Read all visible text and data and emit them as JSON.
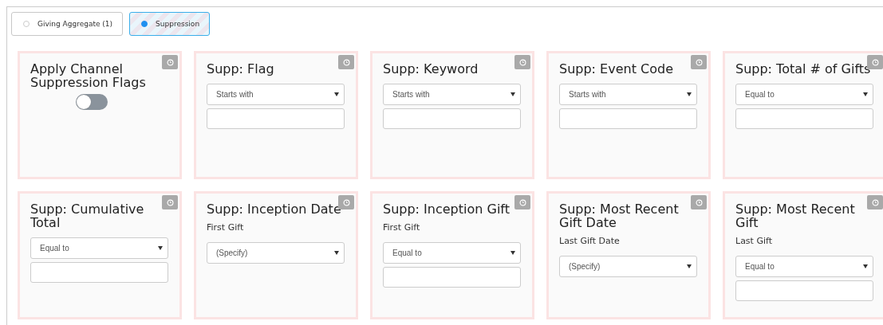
{
  "tabs": [
    {
      "label": "Giving Aggregate (1)",
      "selected": false
    },
    {
      "label": "Suppression",
      "selected": true
    }
  ],
  "cards": [
    {
      "title": "Apply Channel Suppression Flags",
      "controls": [
        {
          "kind": "toggle",
          "on": false
        }
      ]
    },
    {
      "title": "Supp: Flag",
      "controls": [
        {
          "kind": "select",
          "value": "Starts with"
        },
        {
          "kind": "text"
        }
      ]
    },
    {
      "title": "Supp: Keyword",
      "controls": [
        {
          "kind": "select",
          "value": "Starts with"
        },
        {
          "kind": "text"
        }
      ]
    },
    {
      "title": "Supp: Event Code",
      "controls": [
        {
          "kind": "select",
          "value": "Starts with"
        },
        {
          "kind": "text"
        }
      ]
    },
    {
      "title": "Supp: Total # of Gifts",
      "controls": [
        {
          "kind": "select",
          "value": "Equal to"
        },
        {
          "kind": "text"
        }
      ]
    },
    {
      "title": "Supp: Cumulative Total",
      "controls": [
        {
          "kind": "select",
          "value": "Equal to"
        },
        {
          "kind": "text"
        }
      ]
    },
    {
      "title": "Supp: Inception Date",
      "sublabel": "First Gift",
      "controls": [
        {
          "kind": "select",
          "value": "(Specify)"
        }
      ]
    },
    {
      "title": "Supp: Inception Gift",
      "sublabel": "First Gift",
      "controls": [
        {
          "kind": "select",
          "value": "Equal to"
        },
        {
          "kind": "text"
        }
      ]
    },
    {
      "title": "Supp: Most Recent Gift Date",
      "sublabel": "Last Gift Date",
      "controls": [
        {
          "kind": "select",
          "value": "(Specify)"
        }
      ]
    },
    {
      "title": "Supp: Most Recent Gift",
      "sublabel": "Last Gift",
      "controls": [
        {
          "kind": "select",
          "value": "Equal to"
        },
        {
          "kind": "text"
        }
      ]
    }
  ]
}
